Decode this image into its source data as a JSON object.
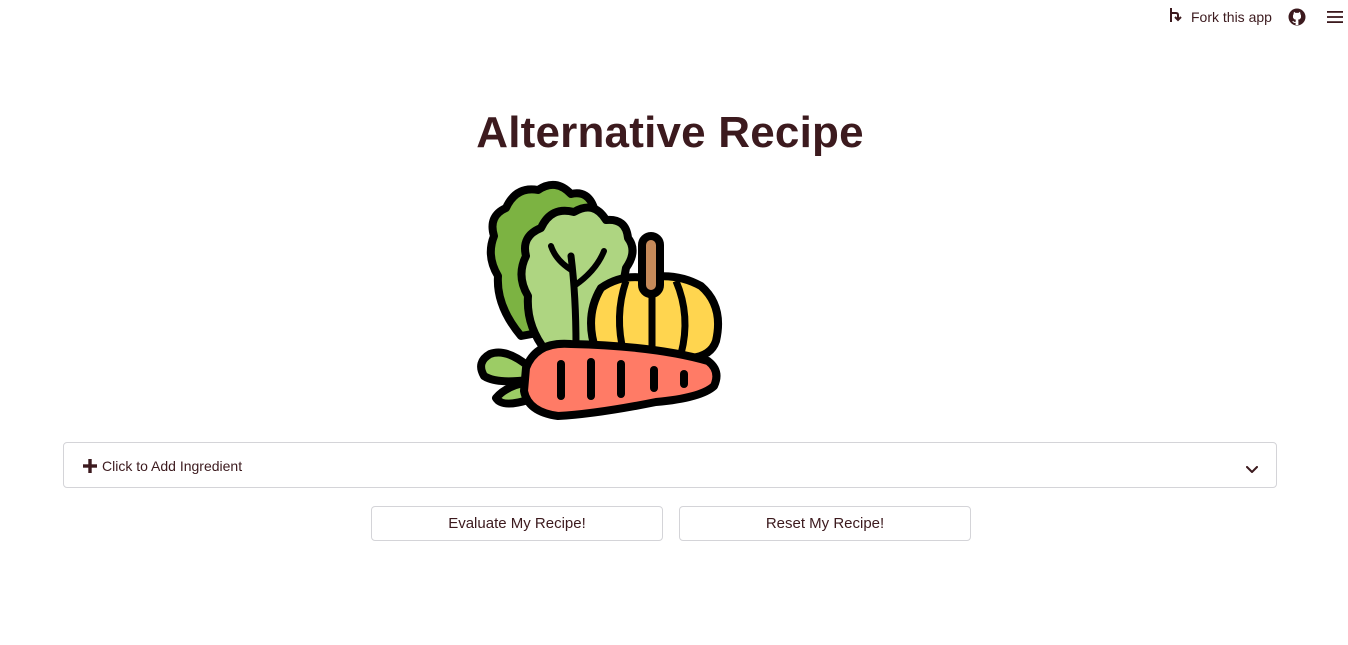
{
  "header": {
    "fork_label": "Fork this app",
    "icons": [
      "fork-icon",
      "github-icon",
      "hamburger-menu-icon"
    ]
  },
  "main": {
    "title": "Alternative Recipe",
    "image_icon": "vegetables-illustration",
    "expander": {
      "label": "Click to Add Ingredient",
      "icon": "plus-icon",
      "state": "collapsed"
    },
    "buttons": {
      "evaluate": "Evaluate My Recipe!",
      "reset": "Reset My Recipe!"
    }
  },
  "colors": {
    "text": "#3c1a1e",
    "border": "#d4d4d8",
    "background": "#ffffff"
  }
}
